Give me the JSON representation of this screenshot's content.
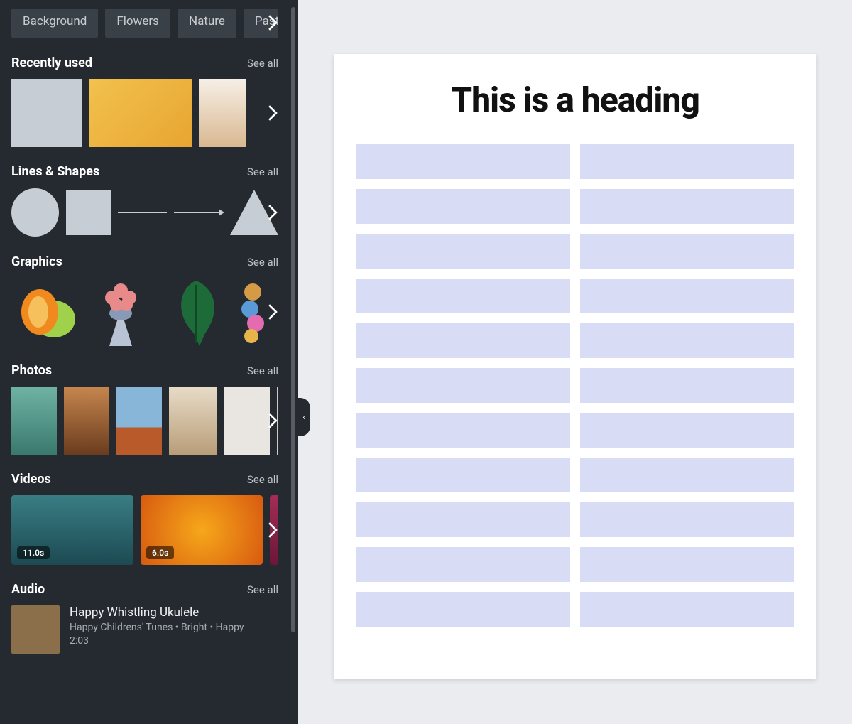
{
  "chips": [
    "Background",
    "Flowers",
    "Nature",
    "Pastel b"
  ],
  "sections": {
    "recent": {
      "title": "Recently used",
      "see_all": "See all"
    },
    "shapes": {
      "title": "Lines & Shapes",
      "see_all": "See all"
    },
    "graphics": {
      "title": "Graphics",
      "see_all": "See all"
    },
    "photos": {
      "title": "Photos",
      "see_all": "See all"
    },
    "videos": {
      "title": "Videos",
      "see_all": "See all"
    },
    "audio": {
      "title": "Audio",
      "see_all": "See all"
    }
  },
  "videos": {
    "items": [
      {
        "duration": "11.0s"
      },
      {
        "duration": "6.0s"
      }
    ]
  },
  "audio": {
    "track": {
      "title": "Happy Whistling Ukulele",
      "subtitle": "Happy Childrens' Tunes • Bright • Happy",
      "time": "2:03"
    }
  },
  "canvas": {
    "heading": "This is a heading",
    "rows": 11,
    "cols": 2,
    "cell_color": "#d8dcf5"
  }
}
